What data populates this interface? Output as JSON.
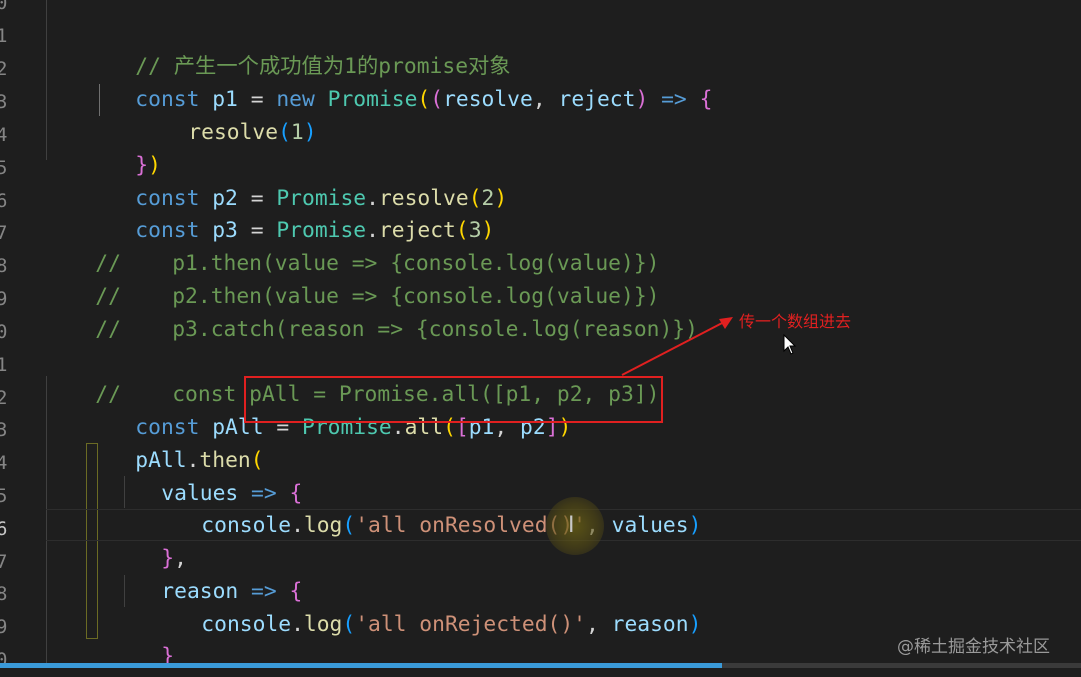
{
  "line_numbers": [
    "0",
    "1",
    "2",
    "3",
    "4",
    "5",
    "6",
    "7",
    "8",
    "9",
    "0",
    "1",
    "2",
    "3",
    "4",
    "5",
    "6",
    "7",
    "8",
    "9",
    "0"
  ],
  "current_line_number": "6",
  "code": {
    "l1": {
      "comment": "// 产生一个成功值为1的promise对象"
    },
    "l2": {
      "t1": "const",
      "t2": "p1",
      "t3": " = ",
      "t4": "new",
      "t5": "Promise",
      "t6": "(",
      "t7": "(",
      "t8": "resolve",
      "t9": ", ",
      "t10": "reject",
      "t11": ")",
      "t12": " => ",
      "t13": "{"
    },
    "l3": {
      "t1": "resolve",
      "t2": "(",
      "t3": "1",
      "t4": ")"
    },
    "l4": {
      "t1": "}",
      "t2": ")"
    },
    "l5": {
      "t1": "const",
      "t2": "p2",
      "t3": " = ",
      "t4": "Promise",
      "t5": ".",
      "t6": "resolve",
      "t7": "(",
      "t8": "2",
      "t9": ")"
    },
    "l6": {
      "t1": "const",
      "t2": "p3",
      "t3": " = ",
      "t4": "Promise",
      "t5": ".",
      "t6": "reject",
      "t7": "(",
      "t8": "3",
      "t9": ")"
    },
    "l7": {
      "comment": "//    p1.then(value => {console.log(value)})"
    },
    "l8": {
      "comment": "//    p2.then(value => {console.log(value)})"
    },
    "l9": {
      "comment": "//    p3.catch(reason => {console.log(reason)})"
    },
    "l11": {
      "comment": "//    const pAll = Promise.all([p1, p2, p3])"
    },
    "l12": {
      "t1": "const",
      "t2": "pAll",
      "t3": " = ",
      "t4": "Promise",
      "t5": ".",
      "t6": "all",
      "t7": "(",
      "t8": "[",
      "t9": "p1",
      "t10": ", ",
      "t11": "p2",
      "t12": "]",
      "t13": ")"
    },
    "l13": {
      "t1": "pAll",
      "t2": ".",
      "t3": "then",
      "t4": "("
    },
    "l14": {
      "t1": "values",
      "t2": " => ",
      "t3": "{"
    },
    "l15": {
      "t1": "console",
      "t2": ".",
      "t3": "log",
      "t4": "(",
      "t5": "'all onResolved()'",
      "t6": ", ",
      "t7": "values",
      "t8": ")"
    },
    "l16": {
      "t1": "}",
      "t2": ","
    },
    "l17": {
      "t1": "reason",
      "t2": " => ",
      "t3": "{"
    },
    "l18": {
      "t1": "console",
      "t2": ".",
      "t3": "log",
      "t4": "(",
      "t5": "'all onRejected()'",
      "t6": ", ",
      "t7": "reason",
      "t8": ")"
    },
    "l19": {
      "t1": "}"
    },
    "l20": {
      "t1": ")"
    }
  },
  "annotation": {
    "text": "传一个数组进去",
    "color": "#e02020"
  },
  "watermark": "@稀土掘金技术社区",
  "text_cursor_glyph": "I",
  "colors": {
    "background": "#1e1e1e",
    "keyword": "#569cd6",
    "variable": "#9cdcfe",
    "class": "#4ec9b0",
    "function": "#dcdcaa",
    "number": "#b5cea8",
    "string": "#ce9178",
    "comment": "#6a9955",
    "scrollbar_thumb": "#3a9ad9"
  }
}
